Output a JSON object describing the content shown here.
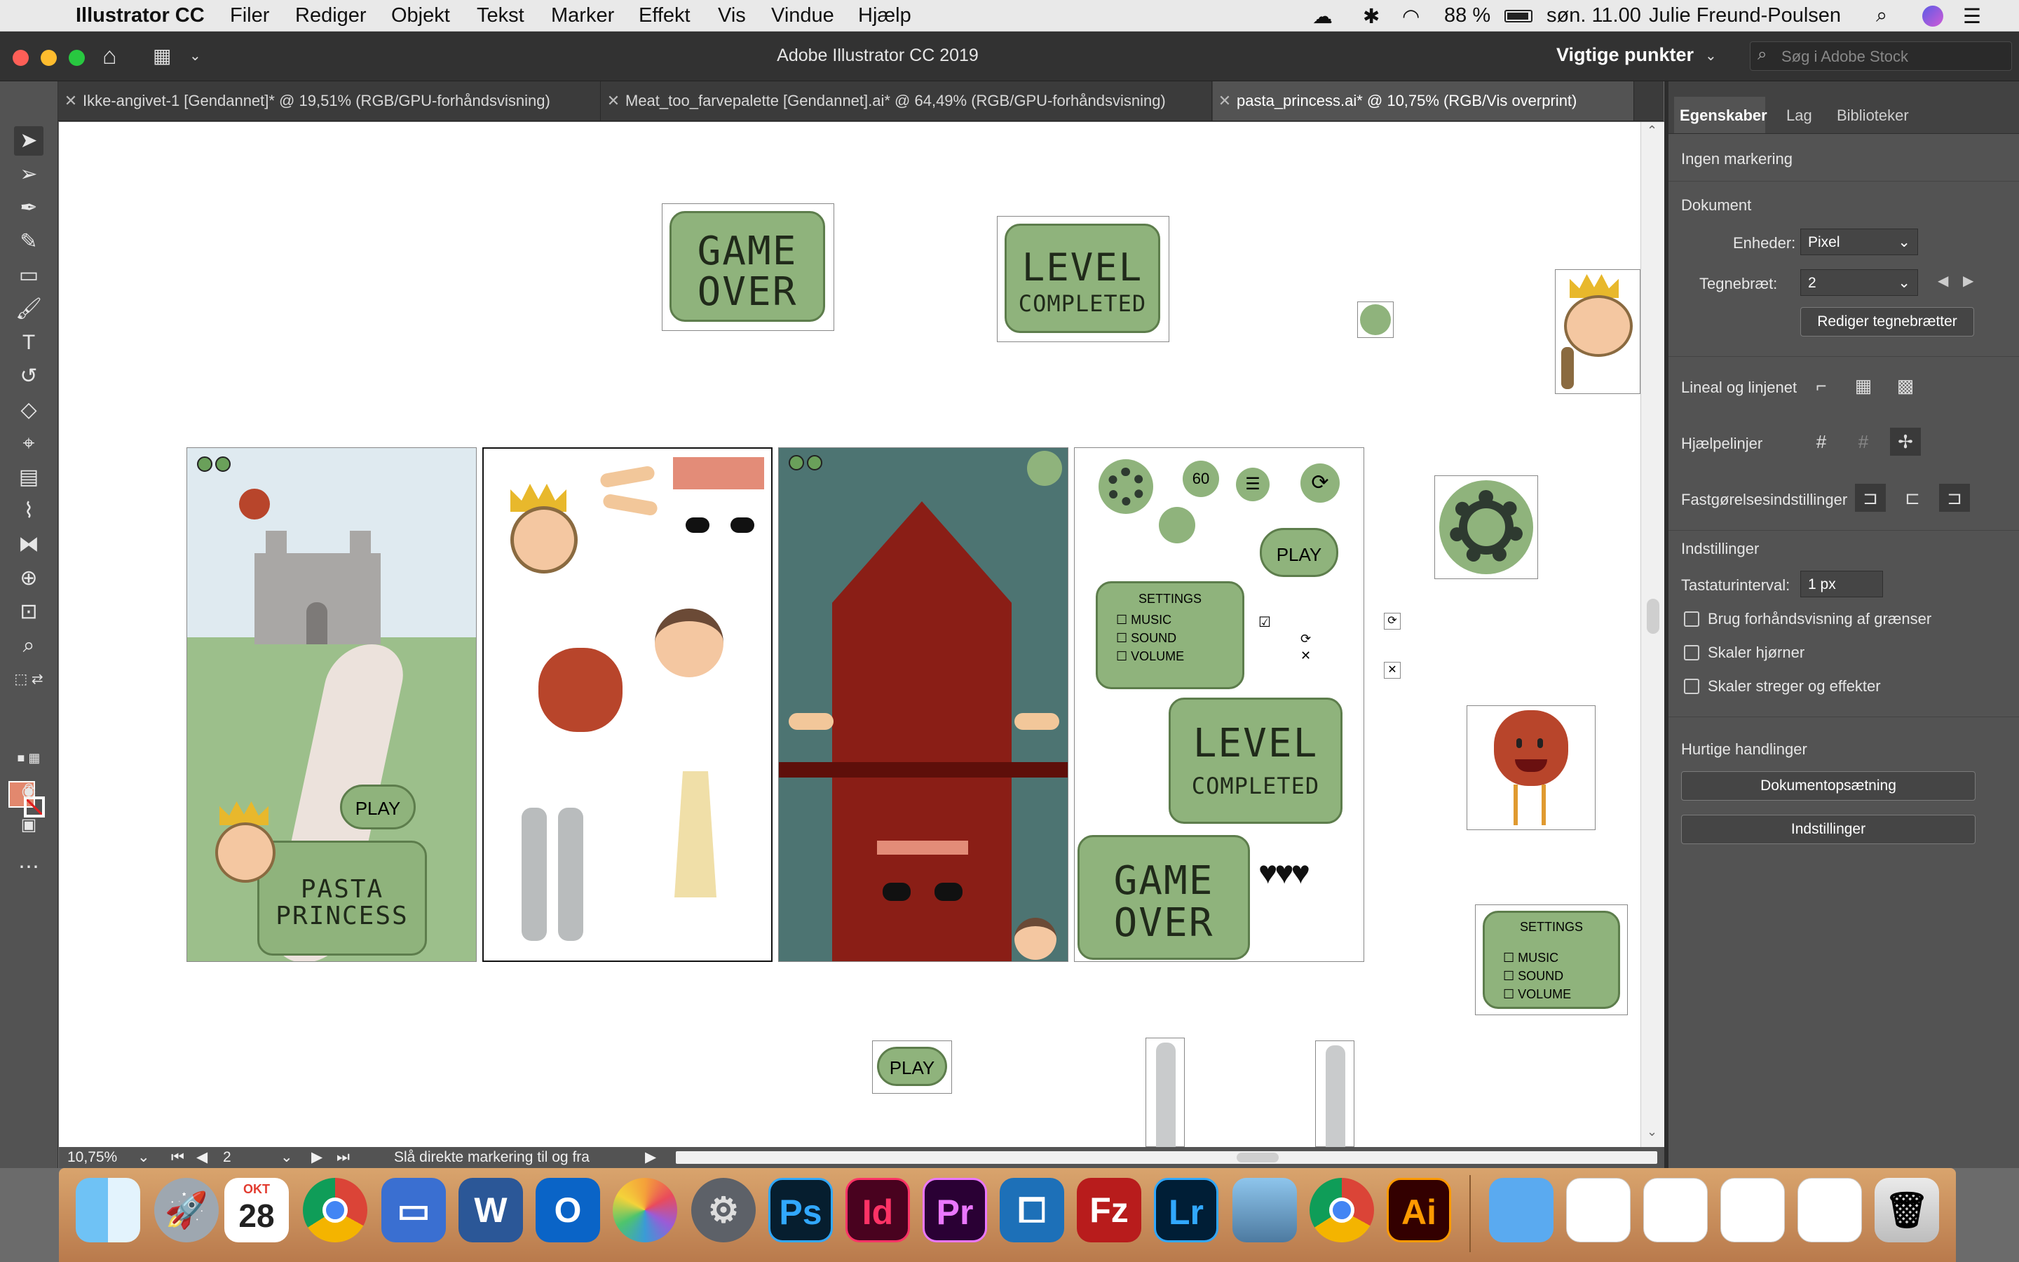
{
  "menubar": {
    "app_name": "Illustrator CC",
    "menus": [
      "Filer",
      "Rediger",
      "Objekt",
      "Tekst",
      "Marker",
      "Effekt",
      "Vis",
      "Vindue",
      "Hjælp"
    ],
    "battery": "88 %",
    "datetime": "søn. 11.00",
    "user": "Julie Freund-Poulsen"
  },
  "appbar": {
    "title": "Adobe Illustrator CC 2019",
    "workspace": "Vigtige punkter",
    "stock_search_placeholder": "Søg i Adobe Stock"
  },
  "tabs": [
    {
      "label": "Ikke-angivet-1 [Gendannet]* @ 19,51% (RGB/GPU-forhåndsvisning)",
      "active": false
    },
    {
      "label": "Meat_too_farvepalette [Gendannet].ai* @ 64,49% (RGB/GPU-forhåndsvisning)",
      "active": false
    },
    {
      "label": "pasta_princess.ai* @ 10,75% (RGB/Vis overprint)",
      "active": true
    }
  ],
  "canvas_text": {
    "game_over_1": "GAME",
    "game_over_2": "OVER",
    "level_1": "LEVEL",
    "level_2": "COMPLETED",
    "play": "PLAY",
    "pasta_1": "PASTA",
    "pasta_2": "PRINCESS",
    "settings_title": "SETTINGS",
    "settings_music": "MUSIC",
    "settings_sound": "SOUND",
    "settings_volume": "VOLUME",
    "timer": "60"
  },
  "colors": {
    "green_button": "#8fb37c",
    "green_dark": "#5d7d4c",
    "sky": "#dfeaf0",
    "grass": "#9cbf8b",
    "teal_bg": "#4d7472",
    "throne_red": "#8a1e16",
    "meatball": "#b8452b",
    "face": "#f4c7a1"
  },
  "panel": {
    "tabs": [
      "Egenskaber",
      "Lag",
      "Biblioteker"
    ],
    "no_selection": "Ingen markering",
    "document_heading": "Dokument",
    "units_label": "Enheder:",
    "units_value": "Pixel",
    "artboard_label": "Tegnebræt:",
    "artboard_value": "2",
    "edit_artboards": "Rediger tegnebrætter",
    "rulers_label": "Lineal og linjenet",
    "guides_label": "Hjælpelinjer",
    "snap_label": "Fastgørelsesindstillinger",
    "settings_heading": "Indstillinger",
    "key_increment_label": "Tastaturinterval:",
    "key_increment_value": "1 px",
    "cb_preview_bounds": "Brug forhåndsvisning af grænser",
    "cb_scale_corners": "Skaler hjørner",
    "cb_scale_strokes": "Skaler streger og effekter",
    "quick_actions": "Hurtige handlinger",
    "btn_document_setup": "Dokumentopsætning",
    "btn_preferences": "Indstillinger"
  },
  "statusbar": {
    "zoom": "10,75%",
    "artboard": "2",
    "hint": "Slå direkte markering til og fra"
  },
  "dock": {
    "calendar_month": "OKT",
    "calendar_day": "28",
    "apps": [
      "Finder",
      "Launchpad",
      "Kalender",
      "Chrome",
      "Keynote",
      "Word",
      "Outlook",
      "Fotos",
      "Systemindstillinger",
      "Photoshop",
      "InDesign",
      "Premiere",
      "Bracket",
      "FileZilla",
      "Lightroom",
      "Preview",
      "Chrome",
      "Illustrator"
    ],
    "app_labels": {
      "ps": "Ps",
      "id": "Id",
      "pr": "Pr",
      "fz": "Fz",
      "lr": "Lr",
      "ai": "Ai",
      "word": "W",
      "outlook": "O"
    }
  }
}
